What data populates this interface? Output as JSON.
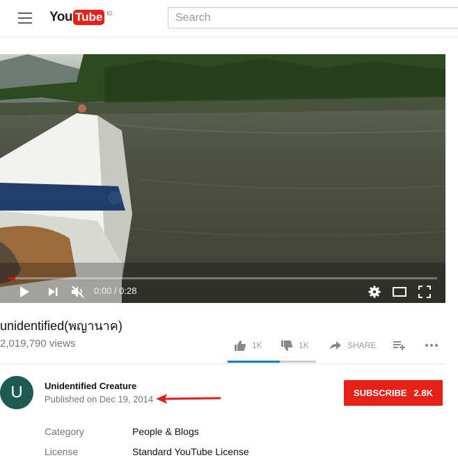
{
  "masthead": {
    "logo_you": "You",
    "logo_tube": "Tube",
    "logo_country": "ID",
    "search_placeholder": "Search"
  },
  "player": {
    "time": "0:00 / 0:28",
    "progress_fraction": 0.0
  },
  "video": {
    "title": "unidentified(พญานาค)",
    "views": "2,019,790 views",
    "like_count": "1K",
    "dislike_count": "1K",
    "share_label": "SHARE"
  },
  "channel": {
    "avatar_letter": "U",
    "name": "Unidentified Creature",
    "published": "Published on Dec 19, 2014",
    "subscribe_label": "SUBSCRIBE",
    "subscriber_count": "2.8K"
  },
  "metadata": {
    "category_label": "Category",
    "category_value": "People & Blogs",
    "license_label": "License",
    "license_value": "Standard YouTube License"
  },
  "colors": {
    "brand_red": "#e62117",
    "like_blue": "#167ac6",
    "annotation_arrow": "#e0201c"
  }
}
